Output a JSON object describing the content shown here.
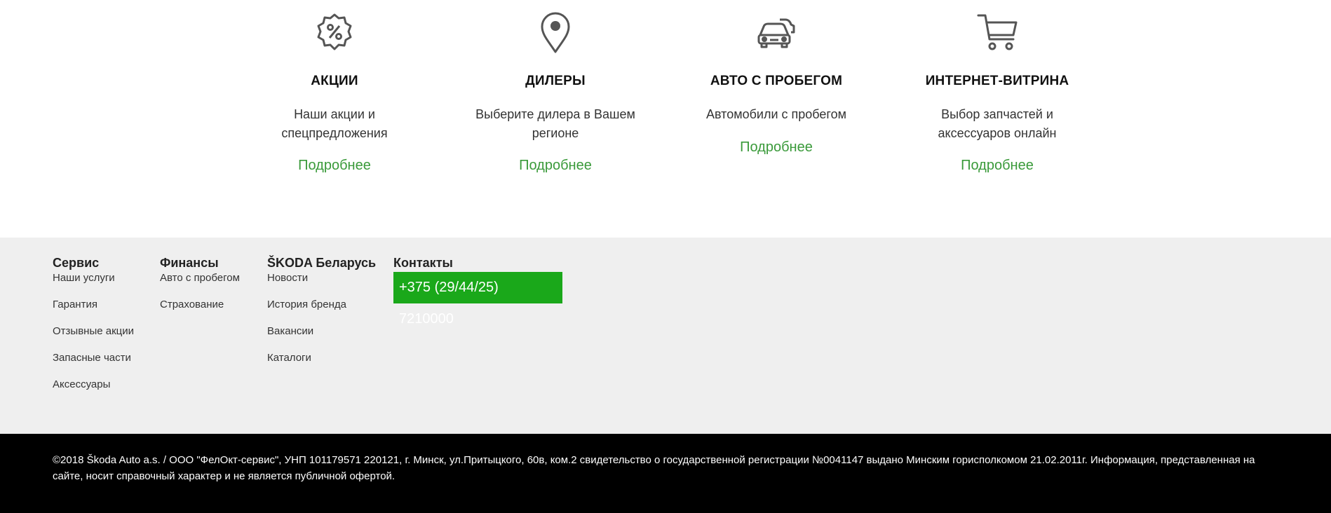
{
  "features": [
    {
      "icon": "percent-badge-icon",
      "title": "АКЦИИ",
      "desc_lines": [
        "Наши акции и",
        "спецпредложения"
      ],
      "more": "Подробнее"
    },
    {
      "icon": "map-pin-icon",
      "title": "ДИЛЕРЫ",
      "desc_lines": [
        "Выберите дилера в Вашем",
        "регионе"
      ],
      "more": "Подробнее"
    },
    {
      "icon": "used-car-icon",
      "title": "АВТО С ПРОБЕГОМ",
      "desc_lines": [
        "Автомобили с пробегом"
      ],
      "more": "Подробнее"
    },
    {
      "icon": "shopping-cart-icon",
      "title": "ИНТЕРНЕТ-ВИТРИНА",
      "desc_lines": [
        "Выбор запчастей и",
        "аксессуаров онлайн"
      ],
      "more": "Подробнее"
    }
  ],
  "footer": {
    "columns": [
      {
        "heading": "Сервис",
        "links": [
          "Наши услуги",
          "Гарантия",
          "Отзывные акции",
          "Запасные части",
          "Аксессуары"
        ]
      },
      {
        "heading": "Финансы",
        "links": [
          "Авто с пробегом",
          "Страхование"
        ]
      },
      {
        "heading": "ŠKODA Беларусь",
        "links": [
          "Новости",
          "История бренда",
          "Вакансии",
          "Каталоги"
        ]
      }
    ],
    "contacts": {
      "heading": "Контакты",
      "phone": "+375 (29/44/25) 7210000"
    }
  },
  "legal": {
    "text": "©2018 Škoda Auto a.s. / ООО \"ФелОкт-сервис\", УНП 101179571 220121, г. Минск, ул.Притыцкого, 60в, ком.2 свидетельство о государственной регистрации №0041147 выдано Минским горисполкомом 21.02.2011г. Информация, представленная на сайте, носит справочный характер и не является публичной офертой."
  },
  "colors": {
    "link_green": "#3a9a3a",
    "phone_bg": "#1aa81a",
    "footer_bg": "#efefef",
    "bottom_bg": "#000000"
  }
}
